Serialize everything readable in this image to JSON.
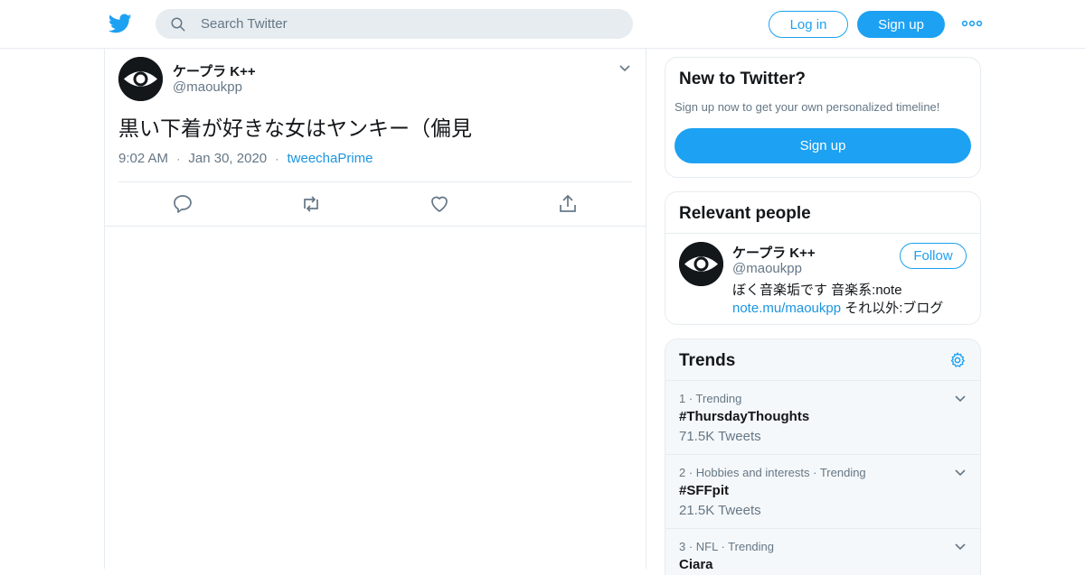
{
  "header": {
    "logo_icon": "twitter-bird-icon",
    "search_placeholder": "Search Twitter",
    "login_label": "Log in",
    "signup_label": "Sign up",
    "more_icon": "more-dots-icon"
  },
  "tweet": {
    "author_name": "ケープラ K++",
    "author_handle": "@maoukpp",
    "text": "黒い下着が好きな女はヤンキー（偏見",
    "time": "9:02 AM",
    "sep1": "·",
    "date": "Jan 30, 2020",
    "sep2": "·",
    "source": "tweechaPrime",
    "actions": [
      "reply-icon",
      "retweet-icon",
      "like-icon",
      "share-icon"
    ]
  },
  "new_to_twitter": {
    "title": "New to Twitter?",
    "subtitle": "Sign up now to get your own personalized timeline!",
    "button": "Sign up"
  },
  "relevant_people": {
    "title": "Relevant people",
    "name": "ケープラ K++",
    "handle": "@maoukpp",
    "follow_label": "Follow",
    "bio_line1": "ぼく音楽垢です 音楽系:note",
    "bio_link": "note.mu/maoukpp",
    "bio_line2_rest": " それ以外:ブログ"
  },
  "trends": {
    "title": "Trends",
    "items": [
      {
        "context": "1 · Trending",
        "tag": "#ThursdayThoughts",
        "count": "71.5K Tweets"
      },
      {
        "context": "2 · Hobbies and interests · Trending",
        "tag": "#SFFpit",
        "count": "21.5K Tweets"
      },
      {
        "context": "3 · NFL · Trending",
        "tag": "Ciara",
        "count": ""
      }
    ]
  },
  "colors": {
    "accent": "#1da1f2",
    "link": "#1b95e0",
    "muted": "#657786",
    "border": "#e6ecf0"
  }
}
